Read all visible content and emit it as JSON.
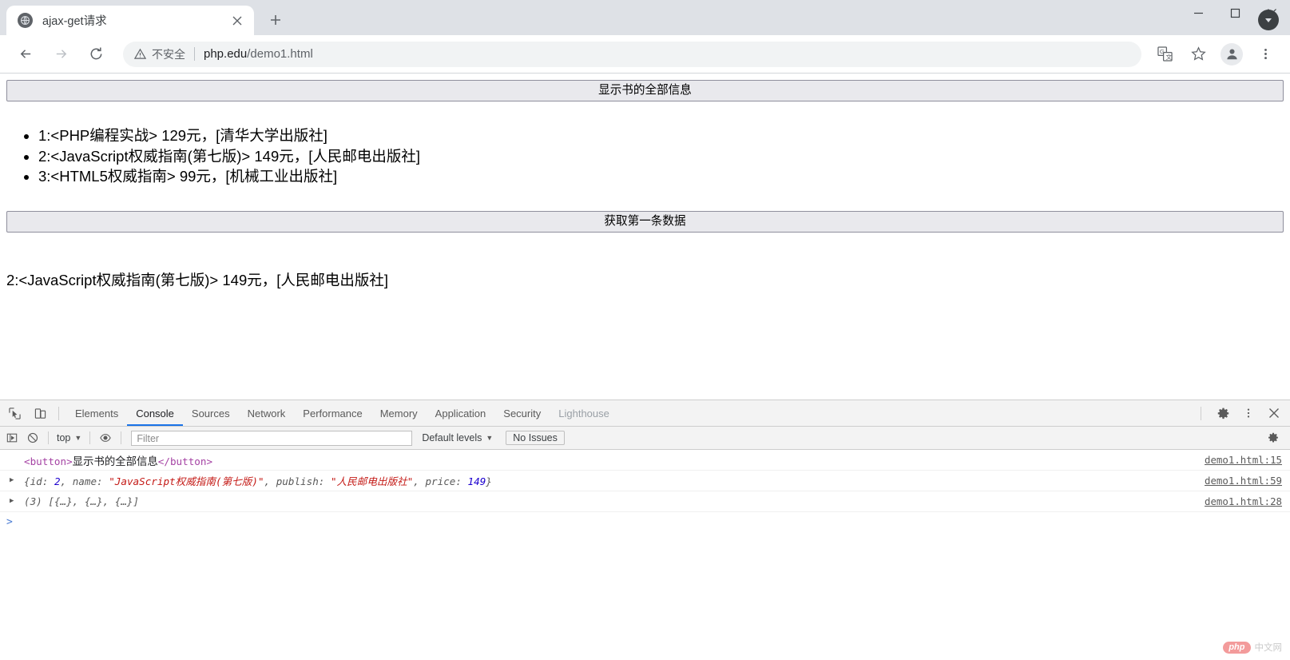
{
  "browser": {
    "tab": {
      "title": "ajax-get请求",
      "favicon_icon": "globe-icon",
      "close_icon": "close-icon"
    },
    "new_tab_label": "+",
    "nav": {
      "back_icon": "arrow-left-icon",
      "forward_icon": "arrow-right-icon",
      "reload_icon": "reload-icon"
    },
    "omnibox": {
      "security_warning": "不安全",
      "warning_icon": "warning-triangle-icon",
      "url_host": "php.edu",
      "url_path": "/demo1.html",
      "url_full": "php.edu/demo1.html"
    },
    "toolbar_icons": {
      "translate": "translate-icon",
      "bookmark": "star-icon",
      "profile": "person-avatar-icon",
      "menu": "three-dot-menu-icon"
    },
    "window_controls": {
      "minimize": "minimize-icon",
      "maximize": "maximize-icon",
      "close": "close-window-icon",
      "downloads_badge": "download-arrow-icon"
    }
  },
  "page": {
    "show_all_button": "显示书的全部信息",
    "books": [
      "1:<PHP编程实战> 129元，[清华大学出版社]",
      "2:<JavaScript权威指南(第七版)> 149元，[人民邮电出版社]",
      "3:<HTML5权威指南> 99元，[机械工业出版社]"
    ],
    "get_first_button": "获取第一条数据",
    "result_text": "2:<JavaScript权威指南(第七版)> 149元，[人民邮电出版社]"
  },
  "devtools": {
    "inspect_icon": "inspect-element-icon",
    "device_toolbar_icon": "device-toolbar-icon",
    "tabs": [
      {
        "label": "Elements",
        "active": false,
        "dim": false
      },
      {
        "label": "Console",
        "active": true,
        "dim": false
      },
      {
        "label": "Sources",
        "active": false,
        "dim": false
      },
      {
        "label": "Network",
        "active": false,
        "dim": false
      },
      {
        "label": "Performance",
        "active": false,
        "dim": false
      },
      {
        "label": "Memory",
        "active": false,
        "dim": false
      },
      {
        "label": "Application",
        "active": false,
        "dim": false
      },
      {
        "label": "Security",
        "active": false,
        "dim": false
      },
      {
        "label": "Lighthouse",
        "active": false,
        "dim": true
      }
    ],
    "right_icons": {
      "settings": "gear-icon",
      "more": "three-dot-menu-icon",
      "close": "close-icon"
    },
    "filterbar": {
      "sidebar_icon": "console-sidebar-icon",
      "clear_icon": "clear-console-icon",
      "context": "top",
      "eye_icon": "live-expression-eye-icon",
      "filter_placeholder": "Filter",
      "filter_value": "",
      "levels": "Default levels",
      "issues": "No Issues",
      "settings_icon": "gear-icon"
    },
    "console_logs": [
      {
        "expandable": false,
        "kind": "element",
        "tag_open": "<button>",
        "inner_text": "显示书的全部信息",
        "tag_close": "</button>",
        "source": "demo1.html:15"
      },
      {
        "expandable": true,
        "kind": "object",
        "object": {
          "open": "{",
          "close": "}",
          "props": [
            {
              "key": "id",
              "value": "2",
              "type": "number"
            },
            {
              "key": "name",
              "value": "\"JavaScript权威指南(第七版)\"",
              "type": "string"
            },
            {
              "key": "publish",
              "value": "\"人民邮电出版社\"",
              "type": "string"
            },
            {
              "key": "price",
              "value": "149",
              "type": "number"
            }
          ]
        },
        "source": "demo1.html:59"
      },
      {
        "expandable": true,
        "kind": "array",
        "length_label": "(3)",
        "preview": "[{…}, {…}, {…}]",
        "source": "demo1.html:28"
      }
    ],
    "prompt_caret": ">"
  },
  "watermark": {
    "php_label": "php",
    "cn_label": "中文网"
  },
  "colors": {
    "accent_blue": "#1a73e8",
    "tabstrip_bg": "#dee1e6",
    "devtools_bg": "#f3f3f3",
    "string_red": "#c41a16",
    "number_blue": "#1c00cf",
    "tag_purple": "#a543a4",
    "link_gray": "#5a5a5a"
  }
}
